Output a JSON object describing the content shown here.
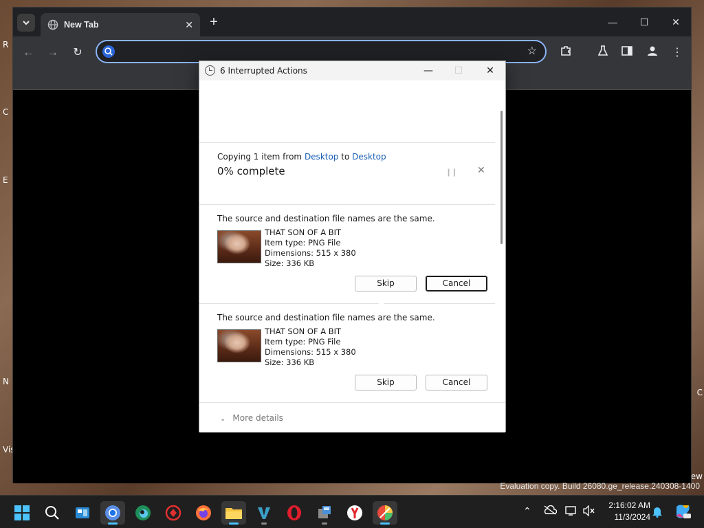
{
  "desktop": {
    "left_fragments": [
      "R",
      "C",
      "E",
      "N",
      "Vis"
    ],
    "right_fragments": [
      "ew",
      "C"
    ]
  },
  "browser": {
    "tab": {
      "title": "New Tab",
      "icon": "globe-icon"
    },
    "controls": {
      "minimize": "—",
      "maximize": "☐",
      "close": "✕"
    },
    "omnibox": {
      "value": "",
      "placeholder": ""
    }
  },
  "dialog": {
    "title": "6 Interrupted Actions",
    "operation": {
      "prefix": "Copying 1 item from ",
      "from": "Desktop",
      "middle": " to ",
      "to": "Desktop",
      "percent": "0% complete"
    },
    "conflicts": [
      {
        "message": "The source and destination file names are the same.",
        "name": "THAT SON OF A BIT",
        "type": "Item type: PNG File",
        "dimensions": "Dimensions: 515 x 380",
        "size": "Size: 336 KB",
        "skip": "Skip",
        "cancel": "Cancel"
      },
      {
        "message": "The source and destination file names are the same.",
        "name": "THAT SON OF A BIT",
        "type": "Item type: PNG File",
        "dimensions": "Dimensions: 515 x 380",
        "size": "Size: 336 KB",
        "skip": "Skip",
        "cancel": "Cancel"
      }
    ],
    "more_details": "More details"
  },
  "watermark": "Evaluation copy. Build 26080.ge_release.240308-1400",
  "taskbar": {
    "time": "2:16:02 AM",
    "date": "11/3/2024",
    "apps": [
      "start-icon",
      "search-icon",
      "widgets-icon",
      "chrome-icon",
      "edge-icon",
      "app-red-icon",
      "firefox-icon",
      "file-explorer-icon",
      "visual-studio-icon",
      "opera-icon",
      "app-tools-icon",
      "yandex-icon",
      "app-colorful-icon"
    ]
  }
}
